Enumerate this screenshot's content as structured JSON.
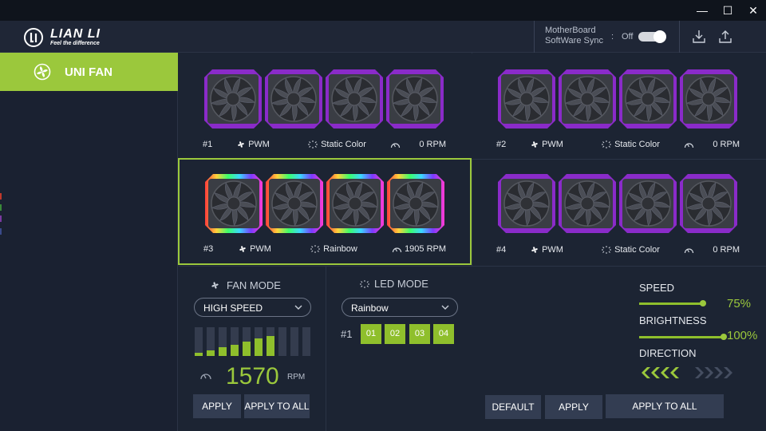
{
  "window": {
    "minimize": "—",
    "maximize": "☐",
    "close": "✕"
  },
  "header": {
    "logo_name": "LIAN LI",
    "logo_tagline": "Feel the difference",
    "sync_label_line1": "MotherBoard",
    "sync_label_line2": "SoftWare Sync",
    "sync_colon": ":",
    "sync_state": "Off",
    "sync_enabled": false,
    "download_icon": "download-icon",
    "upload_icon": "upload-icon"
  },
  "sidebar": {
    "items": [
      {
        "label": "UNI FAN",
        "icon": "fan-icon",
        "active": true
      }
    ]
  },
  "groups": [
    {
      "id": "#1",
      "fan_mode": "PWM",
      "led_mode": "Static Color",
      "rpm": "0 RPM",
      "lighting": "purple",
      "selected": false
    },
    {
      "id": "#2",
      "fan_mode": "PWM",
      "led_mode": "Static Color",
      "rpm": "0 RPM",
      "lighting": "purple",
      "selected": false
    },
    {
      "id": "#3",
      "fan_mode": "PWM",
      "led_mode": "Rainbow",
      "rpm": "1905 RPM",
      "lighting": "rainbow",
      "selected": true
    },
    {
      "id": "#4",
      "fan_mode": "PWM",
      "led_mode": "Static Color",
      "rpm": "0 RPM",
      "lighting": "purple",
      "selected": false
    }
  ],
  "fan_panel": {
    "title": "FAN MODE",
    "mode_value": "HIGH SPEED",
    "curve_levels": [
      0.1,
      0.2,
      0.3,
      0.4,
      0.5,
      0.6,
      0.7,
      0,
      0,
      0
    ],
    "rpm_value": "1570",
    "rpm_unit": "RPM",
    "apply_label": "APPLY",
    "apply_all_label": "APPLY TO ALL"
  },
  "led_panel": {
    "title": "LED MODE",
    "mode_value": "Rainbow",
    "group_id": "#1",
    "zones": [
      "01",
      "02",
      "03",
      "04"
    ],
    "speed_label": "SPEED",
    "speed_value": "75%",
    "speed_fraction": 0.75,
    "brightness_label": "BRIGHTNESS",
    "brightness_value": "100%",
    "brightness_fraction": 1.0,
    "direction_label": "DIRECTION",
    "direction_selected": "left",
    "default_label": "DEFAULT",
    "apply_label": "APPLY",
    "apply_all_label": "APPLY TO ALL"
  },
  "colors": {
    "accent": "#9bc83c",
    "background": "#1c2433",
    "purple_led": "#8a2bc9"
  }
}
